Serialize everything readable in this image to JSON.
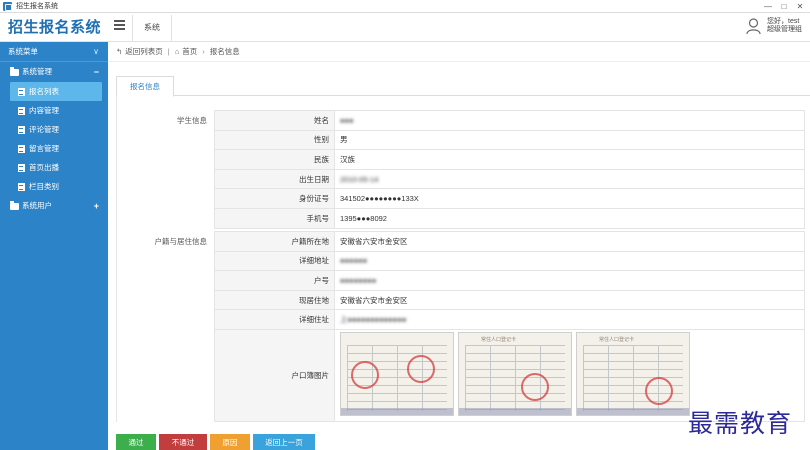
{
  "window": {
    "title": "招生报名系统",
    "controls": [
      "—",
      "□",
      "✕"
    ]
  },
  "header": {
    "logo": "招生报名系统",
    "top_tab": "系统",
    "user_greeting": "您好，test",
    "user_role": "超级管理组"
  },
  "sidebar": {
    "header": "系统菜单",
    "groups": [
      {
        "label": "系统管理",
        "sign": "−"
      },
      {
        "label": "系统用户",
        "sign": "+"
      }
    ],
    "items": [
      {
        "label": "报名列表",
        "active": true
      },
      {
        "label": "内容管理"
      },
      {
        "label": "评论管理"
      },
      {
        "label": "留言管理"
      },
      {
        "label": "首页出播"
      },
      {
        "label": "栏目类别"
      }
    ]
  },
  "breadcrumb": {
    "back": "返回列表页",
    "home": "首页",
    "current": "报名信息"
  },
  "tab": "报名信息",
  "student_section": {
    "label": "学生信息",
    "rows": [
      {
        "key": "姓名",
        "value": "●●●"
      },
      {
        "key": "性别",
        "value": "男"
      },
      {
        "key": "民族",
        "value": "汉族"
      },
      {
        "key": "出生日期",
        "value": "2010-05-14"
      },
      {
        "key": "身份证号",
        "value": "341502●●●●●●●●133X"
      },
      {
        "key": "手机号",
        "value": "1395●●●8092"
      }
    ]
  },
  "residence_section": {
    "label": "户籍与居住信息",
    "rows": [
      {
        "key": "户籍所在地",
        "value": "安徽省六安市金安区"
      },
      {
        "key": "详细地址",
        "value": "●●●●●●"
      },
      {
        "key": "户号",
        "value": "●●●●●●●●"
      },
      {
        "key": "现居住地",
        "value": "安徽省六安市金安区"
      },
      {
        "key": "详细住址",
        "value": "上●●●●●●●●●●●●●"
      },
      {
        "key": "户口簿图片",
        "value": ""
      }
    ]
  },
  "photos": [
    {
      "header": ""
    },
    {
      "header": "常住人口登记卡"
    },
    {
      "header": "常住人口登记卡"
    }
  ],
  "buttons": {
    "pass": "通过",
    "reject": "不通过",
    "reason": "原因",
    "back": "返回上一页"
  },
  "watermark": "最需教育",
  "colors": {
    "sidebar": "#2c83c7",
    "active_item": "#5eb7ea",
    "pass": "#3cae4c",
    "reject": "#c23d3d",
    "reason": "#f0a030",
    "back": "#3aa3dc"
  }
}
